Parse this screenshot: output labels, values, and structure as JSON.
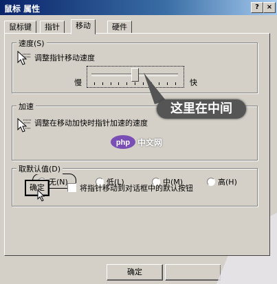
{
  "window": {
    "title": "鼠标 属性",
    "help_button": "?",
    "close_button": "×"
  },
  "tabs": [
    {
      "label": "鼠标键"
    },
    {
      "label": "指针"
    },
    {
      "label": "移动"
    },
    {
      "label": "硬件"
    }
  ],
  "speed_group": {
    "legend": "速度(S)",
    "description": "调整指针移动速度",
    "slow": "慢",
    "fast": "快",
    "slider_value_fraction": 0.5
  },
  "accel_group": {
    "legend": "加速",
    "description": "调整在移动加快时指针加速的速度",
    "options": [
      {
        "label": "无(N)",
        "checked": true
      },
      {
        "label": "低(L)",
        "checked": false
      },
      {
        "label": "中(M)",
        "checked": false
      },
      {
        "label": "高(H)",
        "checked": false
      }
    ]
  },
  "snap_group": {
    "legend": "取默认值(D)",
    "button": "确定",
    "checkbox_label": "将指针移动到对话框中的默认按钮",
    "checked": false
  },
  "callout": {
    "text": "这里在中间"
  },
  "footer": {
    "ok_label": "确定"
  },
  "watermark": {
    "text": "php中文网"
  },
  "colors": {
    "titlebar_start": "#0a246a",
    "titlebar_end": "#a6caf0",
    "face": "#d4d0c8",
    "callout_bg": "#555555",
    "watermark_purple": "#7a4fb5"
  }
}
